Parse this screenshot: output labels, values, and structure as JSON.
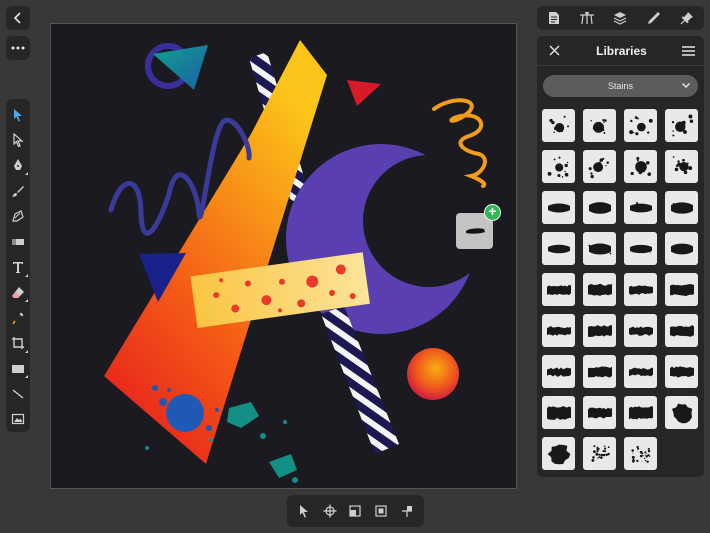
{
  "libraries": {
    "title": "Libraries",
    "category": "Stains",
    "brushes": [
      {
        "name": "splatter-brush-1"
      },
      {
        "name": "splatter-brush-2"
      },
      {
        "name": "splatter-brush-3"
      },
      {
        "name": "splatter-brush-4"
      },
      {
        "name": "splatter-brush-5"
      },
      {
        "name": "splatter-brush-6"
      },
      {
        "name": "splatter-brush-7"
      },
      {
        "name": "splatter-brush-8"
      },
      {
        "name": "streak-brush-1"
      },
      {
        "name": "streak-brush-2"
      },
      {
        "name": "streak-brush-3"
      },
      {
        "name": "streak-brush-4"
      },
      {
        "name": "streak-brush-5"
      },
      {
        "name": "streak-brush-6"
      },
      {
        "name": "streak-brush-7"
      },
      {
        "name": "streak-brush-8"
      },
      {
        "name": "rough-brush-1"
      },
      {
        "name": "rough-brush-2"
      },
      {
        "name": "rough-brush-3"
      },
      {
        "name": "rough-brush-4"
      },
      {
        "name": "rough-brush-5"
      },
      {
        "name": "rough-brush-6"
      },
      {
        "name": "rough-brush-7"
      },
      {
        "name": "rough-brush-8"
      },
      {
        "name": "rough-brush-9"
      },
      {
        "name": "rough-brush-10"
      },
      {
        "name": "rough-brush-11"
      },
      {
        "name": "rough-brush-12"
      },
      {
        "name": "rough-brush-13"
      },
      {
        "name": "rough-brush-14"
      },
      {
        "name": "rough-brush-15"
      },
      {
        "name": "blot-brush-1"
      },
      {
        "name": "blot-brush-2"
      },
      {
        "name": "speckle-brush-1"
      },
      {
        "name": "speckle-brush-2"
      }
    ]
  },
  "studio_tabs": [
    "document-icon",
    "brush-icon",
    "layers-icon",
    "pencil-icon",
    "pin-icon"
  ],
  "tools": [
    "move-icon",
    "node-icon",
    "pen-icon",
    "brush-tool-icon",
    "fill-icon",
    "gradient-icon",
    "text-icon",
    "eraser-icon",
    "eyedropper-icon",
    "crop-icon",
    "rectangle-icon",
    "line-icon",
    "place-image-icon"
  ],
  "colors": {
    "background": "#383838",
    "panel": "#262626",
    "canvas": "#1b1a20",
    "accent": "#4aa8f5",
    "add": "#2fb855"
  }
}
